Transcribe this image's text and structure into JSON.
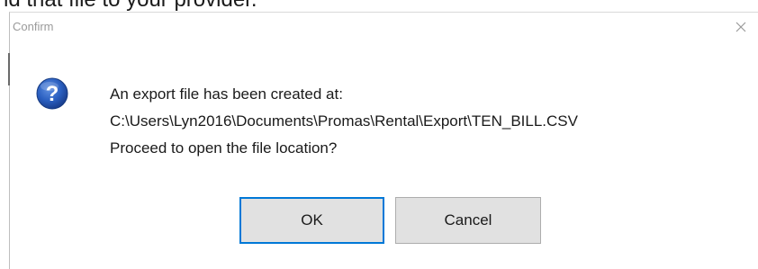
{
  "background": {
    "text": "nd that file to your provider."
  },
  "dialog": {
    "title": "Confirm",
    "close_glyph": "×",
    "icon": "question-icon",
    "message_lines": [
      "An export file has been created at:",
      "C:\\Users\\Lyn2016\\Documents\\Promas\\Rental\\Export\\TEN_BILL.CSV",
      "Proceed to open the file location?"
    ],
    "buttons": {
      "ok_label": "OK",
      "cancel_label": "Cancel"
    }
  },
  "colors": {
    "icon_blue": "#1f57b8",
    "focus_border": "#0078d7",
    "button_face": "#e1e1e1"
  }
}
